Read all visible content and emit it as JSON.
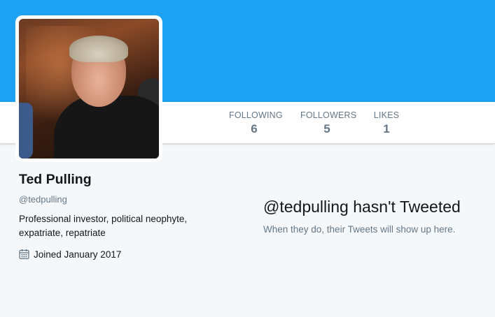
{
  "colors": {
    "banner": "#1da1f2",
    "page_background": "#f5f8fa",
    "muted_text": "#657786",
    "primary_text": "#14171a"
  },
  "stats": {
    "following": {
      "label": "FOLLOWING",
      "value": "6"
    },
    "followers": {
      "label": "FOLLOWERS",
      "value": "5"
    },
    "likes": {
      "label": "LIKES",
      "value": "1"
    }
  },
  "profile": {
    "name": "Ted Pulling",
    "handle": "@tedpulling",
    "bio": "Professional investor, political neophyte, expatriate, repatriate",
    "joined": "Joined January 2017",
    "joined_icon": "calendar-icon"
  },
  "empty_state": {
    "handle": "@tedpulling",
    "title_suffix": " hasn't Tweeted",
    "subtitle": "When they do, their Tweets will show up here."
  }
}
